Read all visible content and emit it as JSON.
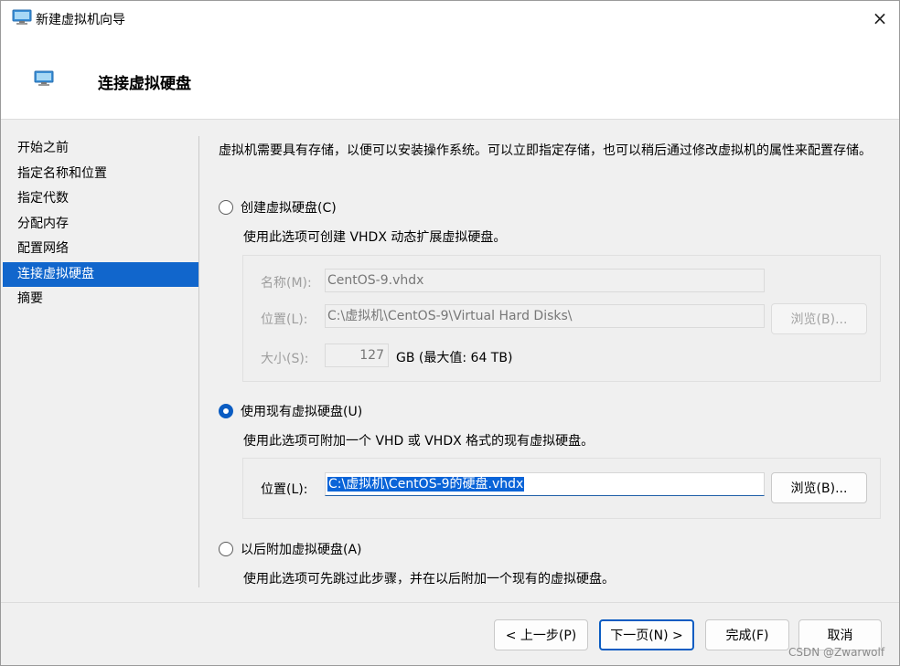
{
  "window": {
    "title": "新建虚拟机向导",
    "close_icon": "×"
  },
  "header": {
    "title": "连接虚拟硬盘"
  },
  "steps": [
    {
      "label": "开始之前",
      "active": false
    },
    {
      "label": "指定名称和位置",
      "active": false
    },
    {
      "label": "指定代数",
      "active": false
    },
    {
      "label": "分配内存",
      "active": false
    },
    {
      "label": "配置网络",
      "active": false
    },
    {
      "label": "连接虚拟硬盘",
      "active": true
    },
    {
      "label": "摘要",
      "active": false
    }
  ],
  "content": {
    "description": "虚拟机需要具有存储，以便可以安装操作系统。可以立即指定存储，也可以稍后通过修改虚拟机的属性来配置存储。",
    "option_create": {
      "label": "创建虚拟硬盘(C)",
      "checked": false,
      "description": "使用此选项可创建 VHDX 动态扩展虚拟硬盘。",
      "name_label": "名称(M):",
      "name_value": "CentOS-9.vhdx",
      "location_label": "位置(L):",
      "location_value": "C:\\虚拟机\\CentOS-9\\Virtual Hard Disks\\",
      "browse_label": "浏览(B)...",
      "size_label": "大小(S):",
      "size_value": "127",
      "size_unit": "GB (最大值: 64 TB)"
    },
    "option_existing": {
      "label": "使用现有虚拟硬盘(U)",
      "checked": true,
      "description": "使用此选项可附加一个 VHD 或 VHDX 格式的现有虚拟硬盘。",
      "location_label": "位置(L):",
      "location_value": "C:\\虚拟机\\CentOS-9的硬盘.vhdx",
      "browse_label": "浏览(B)..."
    },
    "option_later": {
      "label": "以后附加虚拟硬盘(A)",
      "checked": false,
      "description": "使用此选项可先跳过此步骤，并在以后附加一个现有的虚拟硬盘。"
    }
  },
  "footer": {
    "prev_label": "< 上一步(P)",
    "next_label": "下一页(N) >",
    "finish_label": "完成(F)",
    "cancel_label": "取消"
  },
  "watermark": "CSDN @Zwarwolf",
  "colors": {
    "accent": "#0a5cc2",
    "selected_step": "#1166cc"
  }
}
